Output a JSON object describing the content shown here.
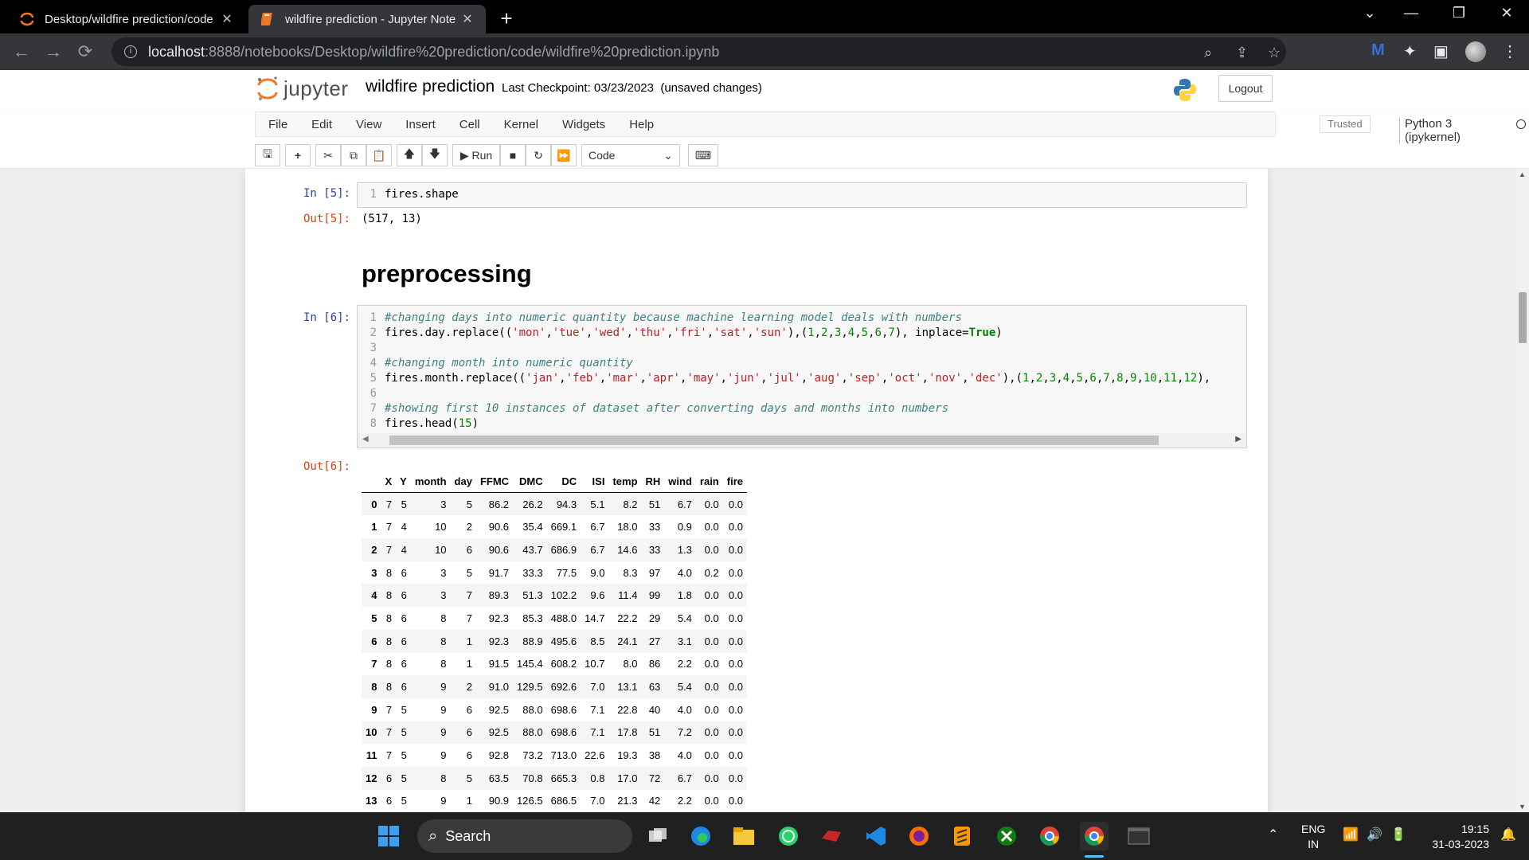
{
  "browser": {
    "tabs": [
      {
        "title": "Desktop/wildfire prediction/code",
        "active": false
      },
      {
        "title": "wildfire prediction - Jupyter Note",
        "active": true
      }
    ],
    "url_host": "localhost",
    "url_rest": ":8888/notebooks/Desktop/wildfire%20prediction/code/wildfire%20prediction.ipynb"
  },
  "jupyter": {
    "logo_text": "jupyter",
    "notebook_name": "wildfire prediction",
    "checkpoint": "Last Checkpoint: 03/23/2023",
    "unsaved": "(unsaved changes)",
    "logout": "Logout",
    "menus": [
      "File",
      "Edit",
      "View",
      "Insert",
      "Cell",
      "Kernel",
      "Widgets",
      "Help"
    ],
    "trusted": "Trusted",
    "kernel": "Python 3 (ipykernel)",
    "run_label": "Run",
    "cell_type": "Code"
  },
  "cells": {
    "in5_prompt": "In [5]:",
    "in5_code": "fires.shape",
    "out5_prompt": "Out[5]:",
    "out5_text": "(517, 13)",
    "heading": "preprocessing",
    "in6_prompt": "In [6]:",
    "out6_prompt": "Out[6]:"
  },
  "dataframe": {
    "columns": [
      "",
      "X",
      "Y",
      "month",
      "day",
      "FFMC",
      "DMC",
      "DC",
      "ISI",
      "temp",
      "RH",
      "wind",
      "rain",
      "fire"
    ],
    "rows": [
      [
        "0",
        "7",
        "5",
        "3",
        "5",
        "86.2",
        "26.2",
        "94.3",
        "5.1",
        "8.2",
        "51",
        "6.7",
        "0.0",
        "0.0"
      ],
      [
        "1",
        "7",
        "4",
        "10",
        "2",
        "90.6",
        "35.4",
        "669.1",
        "6.7",
        "18.0",
        "33",
        "0.9",
        "0.0",
        "0.0"
      ],
      [
        "2",
        "7",
        "4",
        "10",
        "6",
        "90.6",
        "43.7",
        "686.9",
        "6.7",
        "14.6",
        "33",
        "1.3",
        "0.0",
        "0.0"
      ],
      [
        "3",
        "8",
        "6",
        "3",
        "5",
        "91.7",
        "33.3",
        "77.5",
        "9.0",
        "8.3",
        "97",
        "4.0",
        "0.2",
        "0.0"
      ],
      [
        "4",
        "8",
        "6",
        "3",
        "7",
        "89.3",
        "51.3",
        "102.2",
        "9.6",
        "11.4",
        "99",
        "1.8",
        "0.0",
        "0.0"
      ],
      [
        "5",
        "8",
        "6",
        "8",
        "7",
        "92.3",
        "85.3",
        "488.0",
        "14.7",
        "22.2",
        "29",
        "5.4",
        "0.0",
        "0.0"
      ],
      [
        "6",
        "8",
        "6",
        "8",
        "1",
        "92.3",
        "88.9",
        "495.6",
        "8.5",
        "24.1",
        "27",
        "3.1",
        "0.0",
        "0.0"
      ],
      [
        "7",
        "8",
        "6",
        "8",
        "1",
        "91.5",
        "145.4",
        "608.2",
        "10.7",
        "8.0",
        "86",
        "2.2",
        "0.0",
        "0.0"
      ],
      [
        "8",
        "8",
        "6",
        "9",
        "2",
        "91.0",
        "129.5",
        "692.6",
        "7.0",
        "13.1",
        "63",
        "5.4",
        "0.0",
        "0.0"
      ],
      [
        "9",
        "7",
        "5",
        "9",
        "6",
        "92.5",
        "88.0",
        "698.6",
        "7.1",
        "22.8",
        "40",
        "4.0",
        "0.0",
        "0.0"
      ],
      [
        "10",
        "7",
        "5",
        "9",
        "6",
        "92.5",
        "88.0",
        "698.6",
        "7.1",
        "17.8",
        "51",
        "7.2",
        "0.0",
        "0.0"
      ],
      [
        "11",
        "7",
        "5",
        "9",
        "6",
        "92.8",
        "73.2",
        "713.0",
        "22.6",
        "19.3",
        "38",
        "4.0",
        "0.0",
        "0.0"
      ],
      [
        "12",
        "6",
        "5",
        "8",
        "5",
        "63.5",
        "70.8",
        "665.3",
        "0.8",
        "17.0",
        "72",
        "6.7",
        "0.0",
        "0.0"
      ],
      [
        "13",
        "6",
        "5",
        "9",
        "1",
        "90.9",
        "126.5",
        "686.5",
        "7.0",
        "21.3",
        "42",
        "2.2",
        "0.0",
        "0.0"
      ]
    ]
  },
  "taskbar": {
    "search": "Search",
    "lang1": "ENG",
    "lang2": "IN",
    "time": "19:15",
    "date": "31-03-2023"
  }
}
